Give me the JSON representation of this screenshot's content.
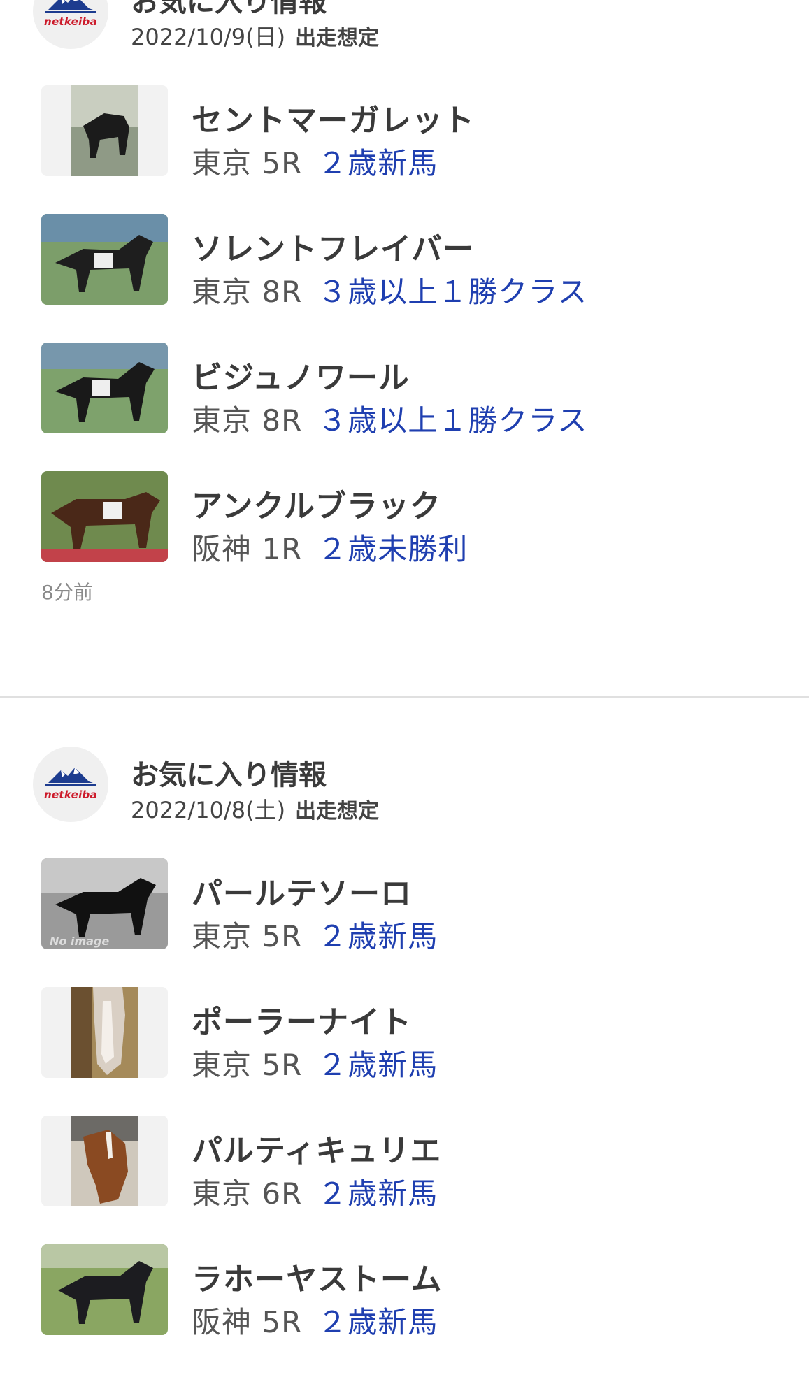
{
  "sections": [
    {
      "logo_text": "netkeiba",
      "title": "お気に入り情報",
      "date": "2022/10/9(日)",
      "tag": "出走想定",
      "items": [
        {
          "name": "セントマーガレット",
          "venue": "東京 5R",
          "race_class": "２歳新馬",
          "photo": "portrait"
        },
        {
          "name": "ソレントフレイバー",
          "venue": "東京 8R",
          "race_class": "３歳以上１勝クラス",
          "photo": "landscape"
        },
        {
          "name": "ビジュノワール",
          "venue": "東京 8R",
          "race_class": "３歳以上１勝クラス",
          "photo": "landscape"
        },
        {
          "name": "アンクルブラック",
          "venue": "阪神 1R",
          "race_class": "２歳未勝利",
          "photo": "landscape"
        }
      ],
      "time_ago": "8分前"
    },
    {
      "logo_text": "netkeiba",
      "title": "お気に入り情報",
      "date": "2022/10/8(土)",
      "tag": "出走想定",
      "items": [
        {
          "name": "パールテソーロ",
          "venue": "東京 5R",
          "race_class": "２歳新馬",
          "photo": "no-image",
          "photo_text": "No image"
        },
        {
          "name": "ポーラーナイト",
          "venue": "東京 5R",
          "race_class": "２歳新馬",
          "photo": "portrait"
        },
        {
          "name": "パルティキュリエ",
          "venue": "東京 6R",
          "race_class": "２歳新馬",
          "photo": "portrait"
        },
        {
          "name": "ラホーヤストーム",
          "venue": "阪神 5R",
          "race_class": "２歳新馬",
          "photo": "landscape"
        }
      ]
    }
  ],
  "colors": {
    "race_class": "#1f3fb0",
    "logo_red": "#cc1a2a",
    "logo_blue": "#1d3c8f",
    "divider": "#e0e0e0"
  }
}
